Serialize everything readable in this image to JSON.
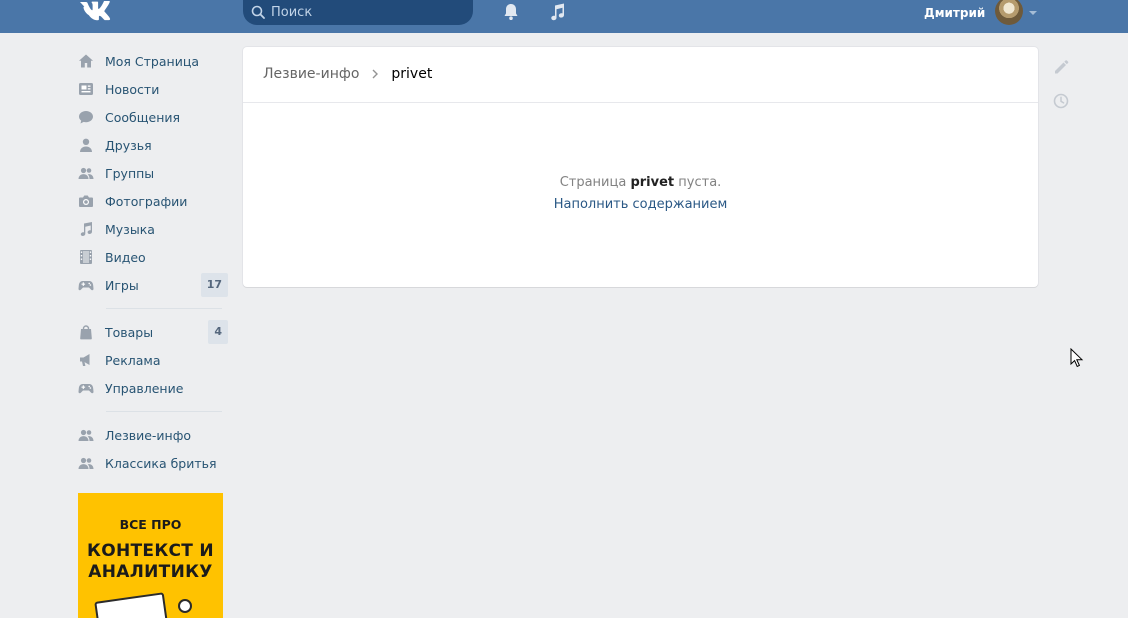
{
  "header": {
    "search_placeholder": "Поиск",
    "user_name": "Дмитрий"
  },
  "sidebar": {
    "items": [
      {
        "label": "Моя Страница",
        "icon": "home-icon"
      },
      {
        "label": "Новости",
        "icon": "news-icon"
      },
      {
        "label": "Сообщения",
        "icon": "messages-icon"
      },
      {
        "label": "Друзья",
        "icon": "friends-icon"
      },
      {
        "label": "Группы",
        "icon": "groups-icon"
      },
      {
        "label": "Фотографии",
        "icon": "camera-icon"
      },
      {
        "label": "Музыка",
        "icon": "music-icon"
      },
      {
        "label": "Видео",
        "icon": "video-icon"
      },
      {
        "label": "Игры",
        "icon": "gamepad-icon",
        "badge": "17"
      }
    ],
    "items2": [
      {
        "label": "Товары",
        "icon": "bag-icon",
        "badge": "4"
      },
      {
        "label": "Реклама",
        "icon": "megaphone-icon"
      },
      {
        "label": "Управление",
        "icon": "gamepad-icon"
      }
    ],
    "items3": [
      {
        "label": "Лезвие-инфо",
        "icon": "group-icon"
      },
      {
        "label": "Классика бритья",
        "icon": "group-icon"
      }
    ]
  },
  "ad": {
    "line1": "ВСЕ ПРО",
    "line2": "КОНТЕКСТ И",
    "line3": "АНАЛИТИКУ"
  },
  "main": {
    "breadcrumb_parent": "Лезвие-инфо",
    "breadcrumb_current": "privet",
    "empty_prefix": "Страница",
    "empty_page": "privet",
    "empty_suffix": "пуста.",
    "fill_link": "Наполнить содержанием"
  },
  "colors": {
    "header": "#4a76a8",
    "background": "#edeef0",
    "link": "#2a5885",
    "sidebar_text": "#285473",
    "icon": "#99a2ad"
  }
}
